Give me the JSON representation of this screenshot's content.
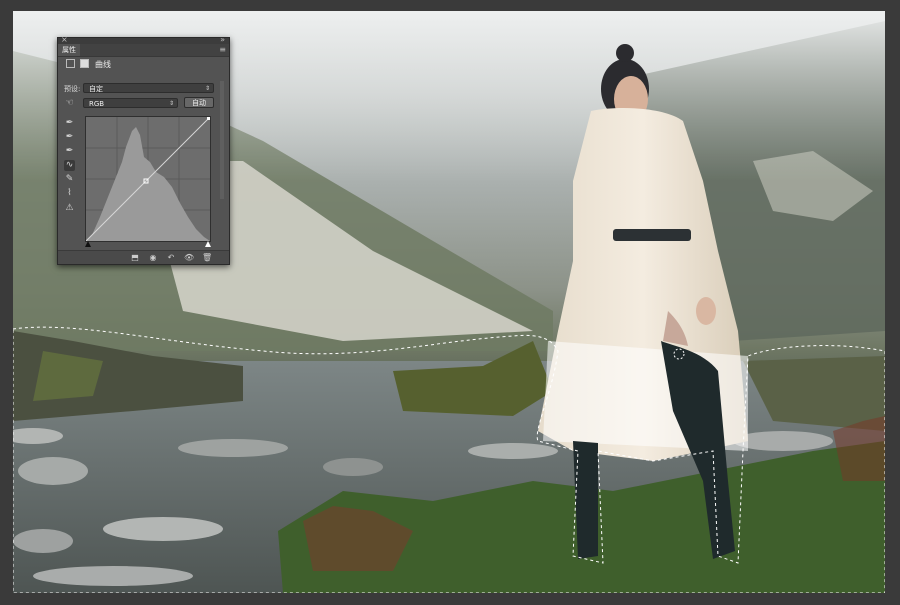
{
  "panel": {
    "tab_label": "属性",
    "close_glyph": "×",
    "collapse_glyph": "»",
    "menu_glyph": "≡",
    "adjustment_label": "曲线",
    "preset_label": "预设:",
    "preset_value": "自定",
    "channel_value": "RGB",
    "auto_button": "自动",
    "tools": [
      "target-adjust-icon",
      "sample-black-eyedropper-icon",
      "sample-gray-eyedropper-icon",
      "sample-white-eyedropper-icon",
      "curve-point-icon",
      "pencil-icon",
      "smooth-icon",
      "clipping-warning-icon"
    ],
    "bottom_icons": [
      "clip-to-layer-icon",
      "view-previous-icon",
      "reset-icon",
      "toggle-visibility-icon",
      "delete-icon"
    ]
  },
  "colors": {
    "panel_bg": "#535353",
    "canvas_bg": "#3a3a3a",
    "histogram_fill": "#9a9a9a",
    "selection_marquee": "#ffffff"
  }
}
